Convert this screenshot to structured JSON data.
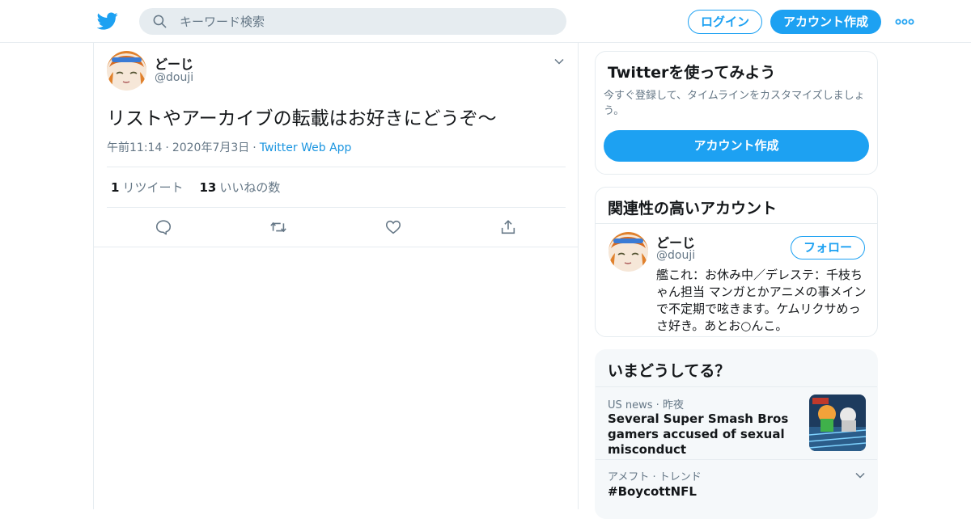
{
  "header": {
    "search_placeholder": "キーワード検索",
    "login_label": "ログイン",
    "signup_label": "アカウント作成"
  },
  "tweet": {
    "author_name": "どーじ",
    "author_handle": "@douji",
    "text": "リストやアーカイブの転載はお好きにどうぞ～",
    "time": "午前11:14",
    "date": "2020年7月3日",
    "source": "Twitter Web App",
    "separator": "·",
    "retweet_count": "1",
    "retweet_label": "リツイート",
    "like_count": "13",
    "like_label": "いいねの数"
  },
  "signup_card": {
    "title": "Twitterを使ってみよう",
    "subtitle": "今すぐ登録して、タイムラインをカスタマイズしましょう。",
    "button": "アカウント作成"
  },
  "related": {
    "title": "関連性の高いアカウント",
    "name": "どーじ",
    "handle": "@douji",
    "follow_label": "フォロー",
    "bio": "艦これ：お休み中／デレステ：千枝ちゃん担当 マンガとかアニメの事メインで不定期で呟きます。ケムリクサめっさ好き。あとお○んこ。"
  },
  "trends": {
    "title": "いまどうしてる？",
    "items": [
      {
        "category": "US news · 昨夜",
        "text": "Several Super Smash Bros gamers accused of sexual misconduct"
      },
      {
        "category": "アメフト · トレンド",
        "text": "#BoycottNFL"
      }
    ]
  },
  "colors": {
    "accent": "#1da1f2",
    "link": "#1b95e0",
    "muted": "#657786",
    "border": "#e6ecf0"
  }
}
